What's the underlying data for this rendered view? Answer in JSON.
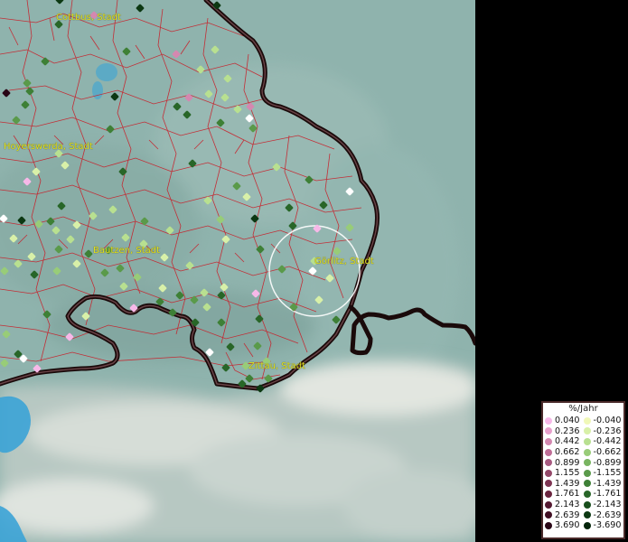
{
  "cities": [
    {
      "id": "cottbus",
      "label": "Cottbus, Stadt"
    },
    {
      "id": "hoyerswerda",
      "label": "Hoyerswerda, Stadt"
    },
    {
      "id": "bautzen",
      "label": "Bautzen, Stadt"
    },
    {
      "id": "goerlitz",
      "label": "Görlitz, Stadt"
    },
    {
      "id": "zittau",
      "label": "Zittau, Stadt"
    }
  ],
  "legend": {
    "title": "%/Jahr",
    "positive": [
      {
        "value": "0.040",
        "color": "#f7b8e8"
      },
      {
        "value": "0.236",
        "color": "#e8a0cc"
      },
      {
        "value": "0.442",
        "color": "#d488b0"
      },
      {
        "value": "0.662",
        "color": "#c06d96"
      },
      {
        "value": "0.899",
        "color": "#a85a80"
      },
      {
        "value": "1.155",
        "color": "#944868"
      },
      {
        "value": "1.439",
        "color": "#7e3452"
      },
      {
        "value": "1.761",
        "color": "#6a243e"
      },
      {
        "value": "2.143",
        "color": "#541830"
      },
      {
        "value": "2.639",
        "color": "#400e22"
      },
      {
        "value": "3.690",
        "color": "#2a0616"
      }
    ],
    "negative": [
      {
        "value": "-0.040",
        "color": "#f0f8b8"
      },
      {
        "value": "-0.236",
        "color": "#d8f0a8"
      },
      {
        "value": "-0.442",
        "color": "#b8e090"
      },
      {
        "value": "-0.662",
        "color": "#98cc78"
      },
      {
        "value": "-0.899",
        "color": "#78b460"
      },
      {
        "value": "-1.155",
        "color": "#5a9a4a"
      },
      {
        "value": "-1.439",
        "color": "#3e8036"
      },
      {
        "value": "-1.761",
        "color": "#286628"
      },
      {
        "value": "-2.143",
        "color": "#184e1c"
      },
      {
        "value": "-2.639",
        "color": "#0c3812"
      },
      {
        "value": "-3.690",
        "color": "#04240a"
      }
    ]
  },
  "colors": {
    "terrain": "#8fb3ad",
    "mountains": "#c4d2cc",
    "water": "#3ba3d6",
    "district_border": "#c8202a",
    "country_border": "#1a0a0a",
    "city_label": "#e0e020",
    "highlight_circle": "#ffffff",
    "nodata_area": "#000000"
  }
}
